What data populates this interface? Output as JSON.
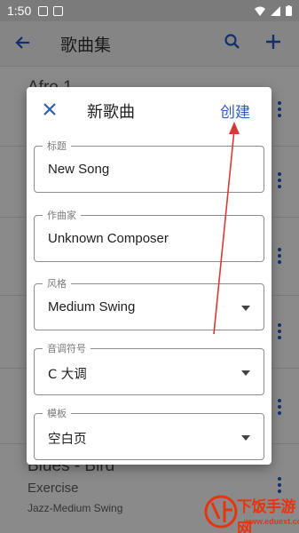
{
  "status_bar": {
    "time": "1:50"
  },
  "app_bar": {
    "title": "歌曲集",
    "icons": [
      "back-arrow-icon",
      "search-icon",
      "add-icon"
    ]
  },
  "list": {
    "items": [
      {
        "title": "Afro 1"
      },
      {
        "title": "Blues - Bird",
        "subtitle": "Exercise",
        "detail": "Jazz-Medium Swing"
      }
    ]
  },
  "dialog": {
    "title": "新歌曲",
    "confirm_label": "创建",
    "fields": [
      {
        "label": "标题",
        "value": "New Song"
      },
      {
        "label": "作曲家",
        "value": "Unknown Composer"
      },
      {
        "label": "风格",
        "value": "Medium Swing"
      },
      {
        "label": "音调符号",
        "value": "C 大调"
      },
      {
        "label": "模板",
        "value": "空白页"
      }
    ]
  },
  "colors": {
    "accent": "#2f5fb3",
    "annotation_arrow": "#d9383a",
    "watermark": "#e8340c"
  },
  "watermark": {
    "text": "下饭手游网",
    "url": "www.eduext.com"
  }
}
